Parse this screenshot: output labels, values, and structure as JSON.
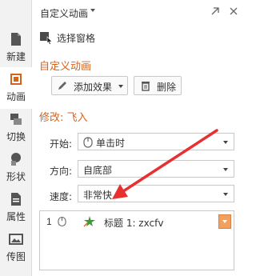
{
  "sidebar": {
    "items": [
      {
        "label": "新建",
        "icon": "new-doc-icon"
      },
      {
        "label": "动画",
        "icon": "animation-icon"
      },
      {
        "label": "切换",
        "icon": "transition-icon"
      },
      {
        "label": "形状",
        "icon": "shape-icon"
      },
      {
        "label": "属性",
        "icon": "property-icon"
      },
      {
        "label": "传图",
        "icon": "upload-image-icon"
      }
    ],
    "active_index": 1
  },
  "panel": {
    "title": "自定义动画",
    "select_pane_label": "选择窗格",
    "section_title": "自定义动画",
    "add_effect_label": "添加效果",
    "delete_label": "删除",
    "modify_title": "修改: 飞入",
    "start_label": "开始:",
    "start_value": "单击时",
    "direction_label": "方向:",
    "direction_value": "自底部",
    "speed_label": "速度:",
    "speed_value": "非常快"
  },
  "animation_list": [
    {
      "index": "1",
      "label": "标题 1: zxcfv"
    }
  ],
  "colors": {
    "accent": "#d9621a",
    "arrow": "#e83030"
  }
}
